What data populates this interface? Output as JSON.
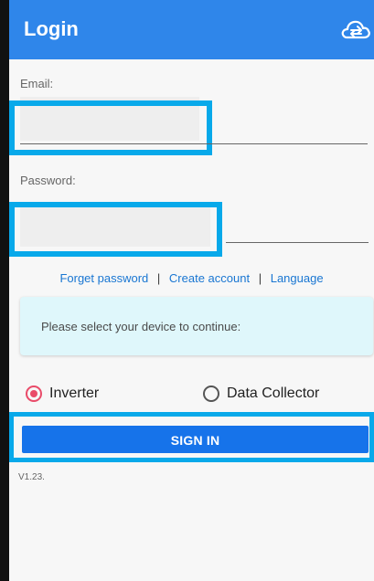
{
  "app": {
    "title": "Login",
    "header_icon": "cloud-sync-icon",
    "accent_color": "#2f86ea"
  },
  "email": {
    "label": "Email:",
    "value": "",
    "placeholder": ""
  },
  "password": {
    "label": "Password:",
    "value": "",
    "placeholder": ""
  },
  "links": {
    "forgot_password": "Forget password",
    "separator_1": "|",
    "create_account": "Create account",
    "separator_2": "|",
    "language": "Language"
  },
  "notice": {
    "text": "Please select your device to continue:"
  },
  "device_options": [
    {
      "label": "Inverter",
      "selected": true
    },
    {
      "label": "Data Collector",
      "selected": false
    }
  ],
  "actions": {
    "sign_in_label": "SIGN IN"
  },
  "footer": {
    "version": "V1.23."
  }
}
